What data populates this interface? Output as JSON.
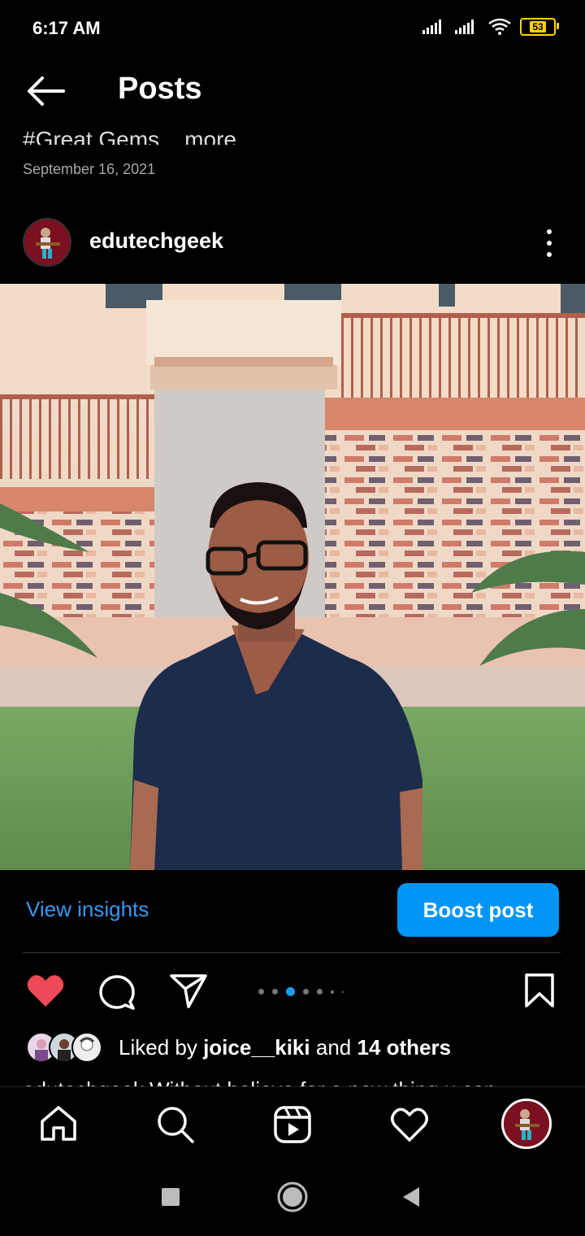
{
  "status_bar": {
    "time": "6:17 AM",
    "battery": "53"
  },
  "header": {
    "title": "Posts"
  },
  "previous_post": {
    "caption_cut": "#Great Gems... more",
    "date": "September 16, 2021"
  },
  "post": {
    "username": "edutechgeek",
    "insights_label": "View insights",
    "boost_label": "Boost post",
    "liked_prefix": "Liked by",
    "liked_user": "joice__kiki",
    "liked_and": "and",
    "liked_others": "14 others",
    "caption_cut": "edutechgeek Without believe for a new thing u can",
    "carousel": {
      "count": 6,
      "active": 3
    }
  },
  "colors": {
    "accent": "#0095f6",
    "link": "#3897f0",
    "like": "#ed4956"
  },
  "icons": {
    "back": "arrow-left-icon",
    "more": "kebab-icon",
    "like": "heart-filled-icon",
    "comment": "comment-icon",
    "share": "send-icon",
    "save": "bookmark-icon"
  },
  "tabs": [
    "home",
    "search",
    "reels",
    "activity",
    "profile"
  ]
}
